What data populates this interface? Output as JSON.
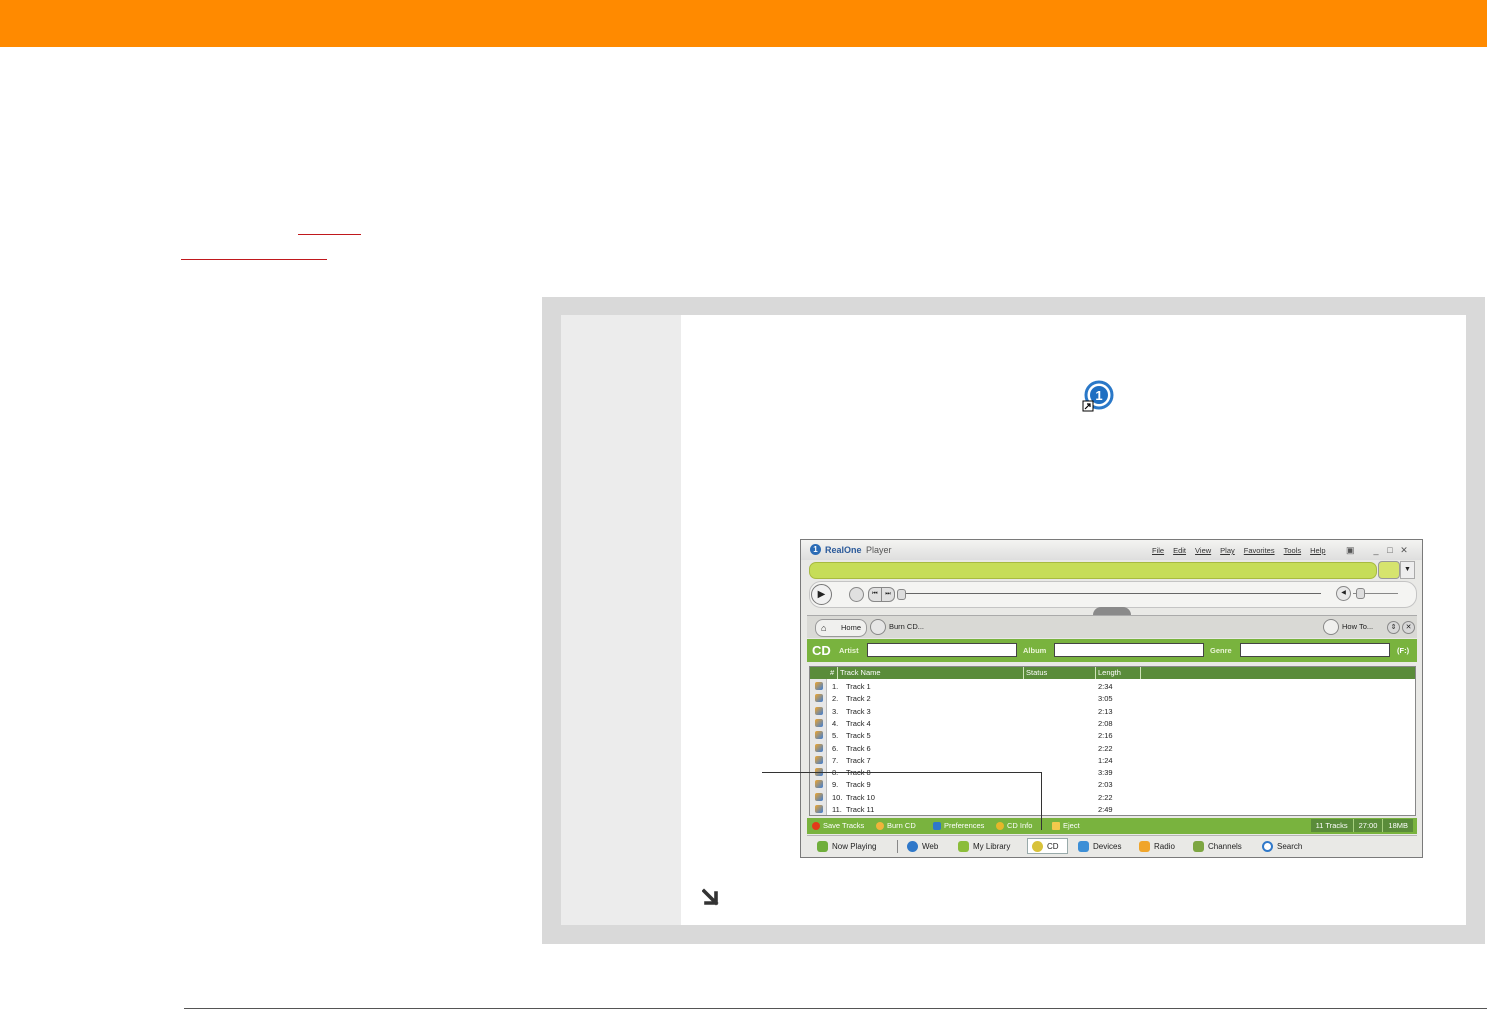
{
  "player": {
    "brand": "RealOne",
    "brand_suffix": "Player",
    "logo_glyph": "1",
    "menus": [
      "File",
      "Edit",
      "View",
      "Play",
      "Favorites",
      "Tools",
      "Help"
    ],
    "nav": {
      "home": "Home",
      "burn": "Burn CD...",
      "howto": "How To..."
    },
    "cd": {
      "title": "CD",
      "artist_label": "Artist",
      "album_label": "Album",
      "genre_label": "Genre",
      "artist_value": "",
      "album_value": "",
      "genre_value": "",
      "drive": "(F:)"
    },
    "columns": {
      "num": "#",
      "name": "Track Name",
      "status": "Status",
      "length": "Length"
    },
    "tracks": [
      {
        "num": "1.",
        "name": "Track 1",
        "length": "2:34"
      },
      {
        "num": "2.",
        "name": "Track 2",
        "length": "3:05"
      },
      {
        "num": "3.",
        "name": "Track 3",
        "length": "2:13"
      },
      {
        "num": "4.",
        "name": "Track 4",
        "length": "2:08"
      },
      {
        "num": "5.",
        "name": "Track 5",
        "length": "2:16"
      },
      {
        "num": "6.",
        "name": "Track 6",
        "length": "2:22"
      },
      {
        "num": "7.",
        "name": "Track 7",
        "length": "1:24"
      },
      {
        "num": "8.",
        "name": "Track 8",
        "length": "3:39"
      },
      {
        "num": "9.",
        "name": "Track 9",
        "length": "2:03"
      },
      {
        "num": "10.",
        "name": "Track 10",
        "length": "2:22"
      },
      {
        "num": "11.",
        "name": "Track 11",
        "length": "2:49"
      }
    ],
    "status": {
      "save_tracks": "Save Tracks",
      "burn_cd": "Burn CD",
      "preferences": "Preferences",
      "cd_info": "CD Info",
      "eject": "Eject",
      "track_count": "11 Tracks",
      "duration": "27:00",
      "size": "18MB"
    },
    "tabs": {
      "now_playing": "Now Playing",
      "web": "Web",
      "my_library": "My Library",
      "cd": "CD",
      "devices": "Devices",
      "radio": "Radio",
      "channels": "Channels",
      "search": "Search"
    }
  },
  "colors": {
    "header_orange": "#ff8a00",
    "player_green": "#79b33e",
    "player_dark_green": "#5a8c3a",
    "url_green": "#c6dd58",
    "link_red": "#c0181d"
  }
}
